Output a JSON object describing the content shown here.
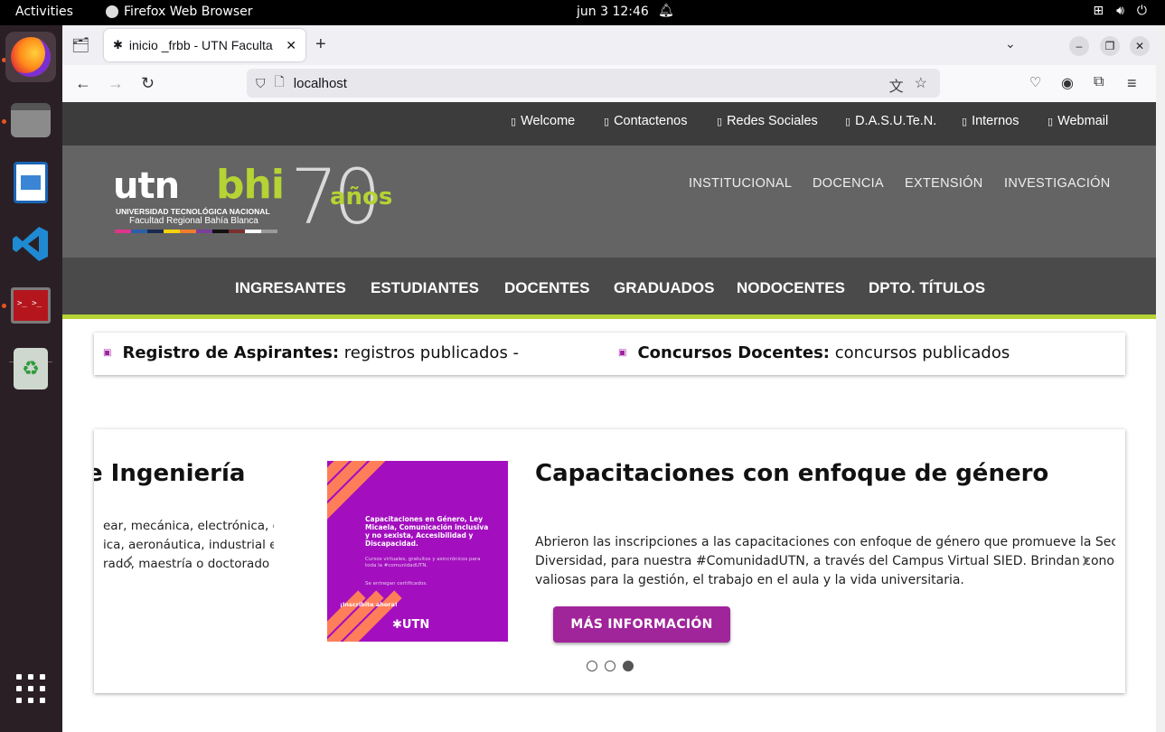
{
  "topbar": {
    "activities": "Activities",
    "app_name": "Firefox Web Browser",
    "clock": "jun 3  12:46"
  },
  "dock": {
    "items": [
      "firefox-icon",
      "files-icon",
      "writer-icon",
      "vscode-icon",
      "terminal-icon",
      "trash-icon",
      "app-grid-icon"
    ]
  },
  "browser": {
    "tab_title": "inicio _frbb - UTN Faculta",
    "url": "localhost"
  },
  "site": {
    "top_links": [
      "Welcome",
      "Contactenos",
      "Redes Sociales",
      "D.A.S.U.Te.N.",
      "Internos",
      "Webmail"
    ],
    "logo": {
      "utn": "utn",
      "bhi": "bhi",
      "line1": "UNIVERSIDAD TECNOLÓGICA NACIONAL",
      "line2": "Facultad Regional Bahía Blanca",
      "seventy": "70",
      "anos": "años"
    },
    "main_nav": [
      "INSTITUCIONAL",
      "DOCENCIA",
      "EXTENSIÓN",
      "INVESTIGACIÓN"
    ],
    "sec_nav": [
      "INGRESANTES",
      "ESTUDIANTES",
      "DOCENTES",
      "GRADUADOS",
      "NODOCENTES",
      "DPTO. TÍTULOS"
    ],
    "ticker": [
      {
        "bold": "Registro de Aspirantes:",
        "text": " registros publicados -"
      },
      {
        "bold": "Concursos Docentes:",
        "text": " concursos publicados"
      }
    ],
    "carousel": {
      "prev_title": "e Ingeniería",
      "prev_lines": [
        "ear, mecánica, electrónica, en",
        "ica, aeronáutica, industrial e",
        "rado, maestría o doctorado"
      ],
      "promo": {
        "title": "Capacitaciones en Género, Ley Micaela, Comunicación inclusiva y no sexista, Accesibilidad y Discapacidad.",
        "sub": "Cursos virtuales, gratuitos y asincrónicos para toda la #comunidadUTN.",
        "cert": "Se entregan certificados.",
        "cta": "¡Inscribite ahora!",
        "logo": "✱UTN"
      },
      "title": "Capacitaciones con enfoque de género",
      "lines": [
        "Abrieron las inscripciones a las capacitaciones con enfoque de género que promueve la Secreta",
        "Diversidad, para nuestra #ComunidadUTN, a través del Campus Virtual SIED. Brindan conocimient",
        "valiosas para la gestión, el trabajo en el aula y la vida universitaria."
      ],
      "button": "MÁS INFORMACIÓN",
      "active_slide": 3,
      "slide_count": 3
    }
  }
}
